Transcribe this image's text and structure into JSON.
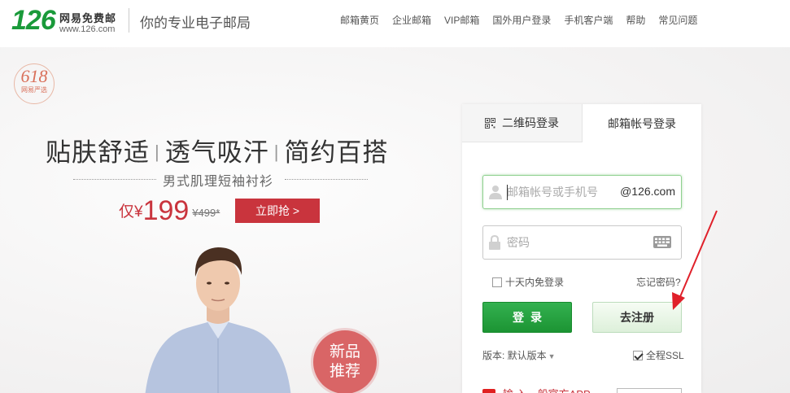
{
  "header": {
    "logo_number": "126",
    "logo_name": "网易免费邮",
    "logo_url": "www.126.com",
    "slogan": "你的专业电子邮局",
    "nav": [
      "邮箱黄页",
      "企业邮箱",
      "VIP邮箱",
      "国外用户登录",
      "手机客户端",
      "帮助",
      "常见问题"
    ]
  },
  "promo": {
    "badge_number": "618",
    "badge_text": "网易严选",
    "headline": [
      "贴肤舒适",
      "透气吸汗",
      "简约百搭"
    ],
    "subtitle": "男式肌理短袖衬衫",
    "price_prefix": "仅¥",
    "price": "199",
    "old_price": "¥499*",
    "buy_label": "立即抢 >",
    "new_badge_line1": "新品",
    "new_badge_line2": "推荐"
  },
  "login": {
    "tab_qr": "二维码登录",
    "tab_account": "邮箱帐号登录",
    "account_placeholder": "邮箱帐号或手机号",
    "account_suffix": "@126.com",
    "password_placeholder": "密码",
    "remember_label": "十天内免登录",
    "forgot_label": "忘记密码?",
    "login_button": "登录",
    "register_button": "去注册",
    "version_label": "版本: 默认版本",
    "ssl_label": "全程SSL",
    "promo_text": "输  入一般官方APP"
  },
  "colors": {
    "brand_green": "#1a9a3a",
    "promo_red": "#c9343d",
    "annotation_arrow": "#e0202a"
  },
  "icons": [
    "user-icon",
    "lock-icon",
    "keyboard-icon",
    "qr-code-icon",
    "chevron-down-icon"
  ]
}
